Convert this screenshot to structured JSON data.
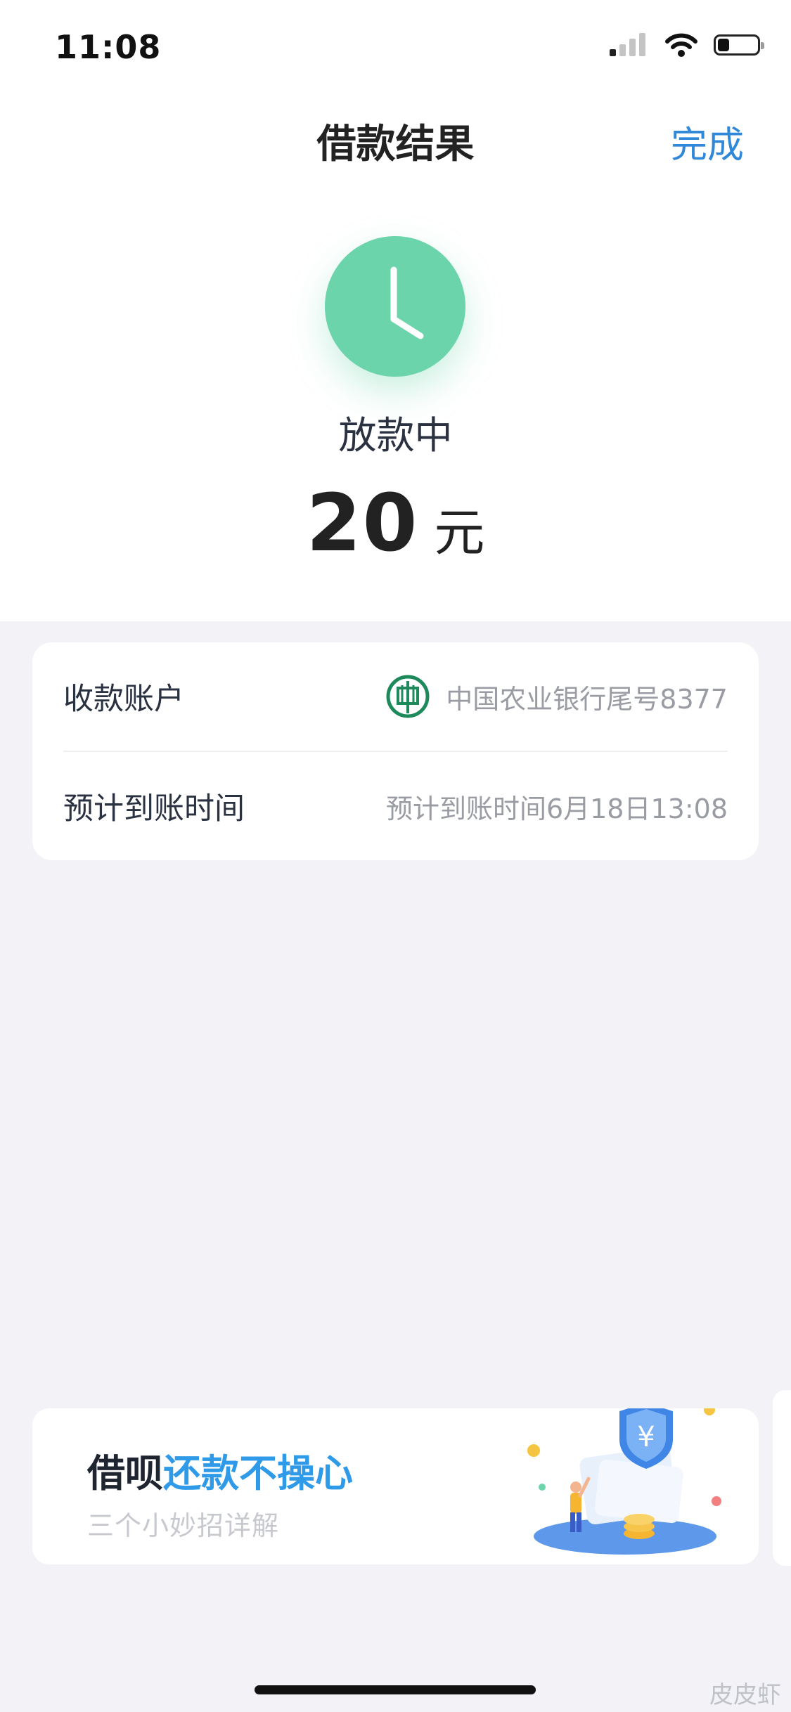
{
  "status_bar": {
    "time": "11:08",
    "battery_level": 0.3
  },
  "nav": {
    "title": "借款结果",
    "done_label": "完成"
  },
  "result": {
    "status": "放款中",
    "amount": "20",
    "unit": "元",
    "icon": "clock-icon",
    "accent_color": "#6cd4ab"
  },
  "info": {
    "account_label": "收款账户",
    "account_value": "中国农业银行尾号8377",
    "account_icon": "abc-bank-logo",
    "eta_label": "预计到账时间",
    "eta_value": "预计到账时间6月18日13:08"
  },
  "promo": {
    "title_dark": "借呗",
    "title_blue": "还款不操心",
    "subtitle": "三个小妙招详解",
    "title_blue_color": "#2f9ae8"
  },
  "watermark": {
    "text": "皮皮虾"
  }
}
